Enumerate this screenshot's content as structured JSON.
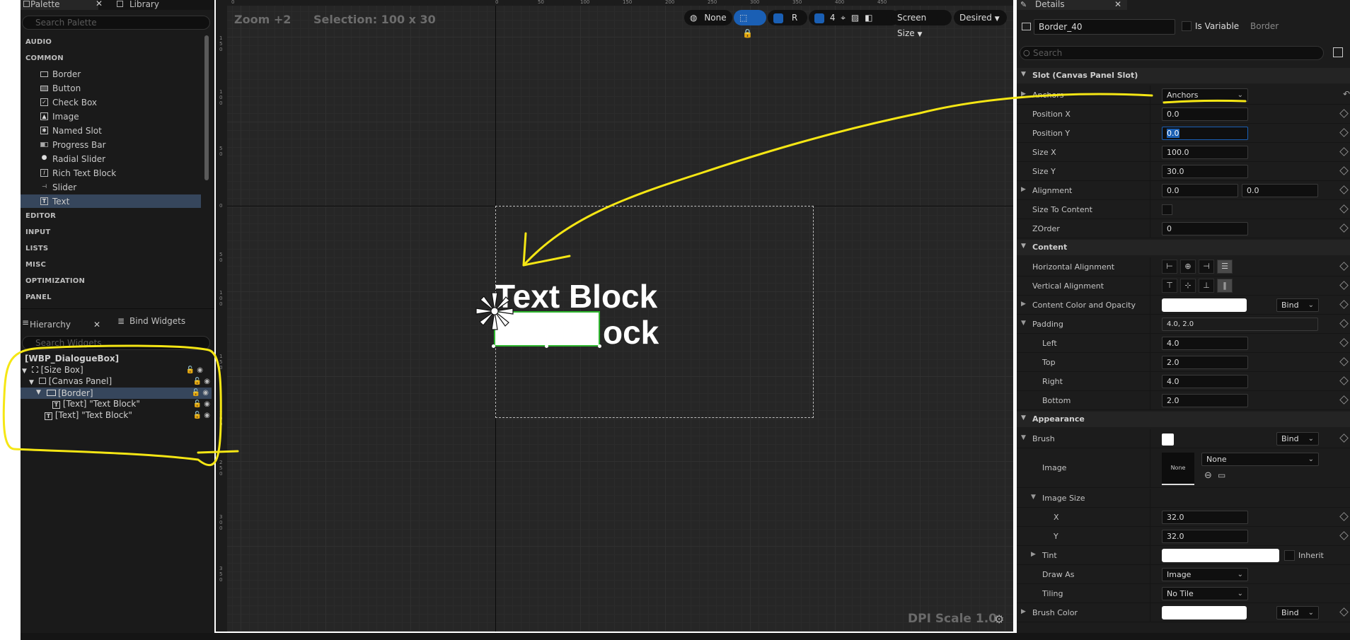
{
  "palette": {
    "tab_palette": "Palette",
    "tab_library": "Library",
    "search_placeholder": "Search Palette",
    "categories": [
      "AUDIO",
      "COMMON",
      "EDITOR",
      "INPUT",
      "LISTS",
      "MISC",
      "OPTIMIZATION",
      "PANEL"
    ],
    "common_items": [
      {
        "label": "Border",
        "icon": "border-icon"
      },
      {
        "label": "Button",
        "icon": "button-icon"
      },
      {
        "label": "Check Box",
        "icon": "checkbox-icon"
      },
      {
        "label": "Image",
        "icon": "image-icon"
      },
      {
        "label": "Named Slot",
        "icon": "named-slot-icon"
      },
      {
        "label": "Progress Bar",
        "icon": "progress-bar-icon"
      },
      {
        "label": "Radial Slider",
        "icon": "radial-slider-icon"
      },
      {
        "label": "Rich Text Block",
        "icon": "rich-text-icon"
      },
      {
        "label": "Slider",
        "icon": "slider-icon"
      },
      {
        "label": "Text",
        "icon": "text-icon"
      }
    ]
  },
  "hierarchy": {
    "tab_hierarchy": "Hierarchy",
    "tab_bind": "Bind Widgets",
    "search_placeholder": "Search Widgets",
    "root": "[WBP_DialogueBox]",
    "rows": [
      "[Size Box]",
      "[Canvas Panel]",
      "[Border]",
      "[Text] \"Text Block\"",
      "[Text] \"Text Block\""
    ]
  },
  "canvas": {
    "zoom": "Zoom +2",
    "selection": "Selection: 100 x 30",
    "toolbar": {
      "none_label": "None",
      "r_label": "R",
      "grid_value": "4",
      "screen_size": "Screen Size",
      "desired": "Desired"
    },
    "text_block_1": "Text Block",
    "text_block_2": "ock",
    "dpi_scale": "DPI Scale 1.0",
    "ruler_top": [
      "0",
      "50",
      "100",
      "150",
      "200",
      "250",
      "300",
      "350",
      "400",
      "450"
    ],
    "ruler_left": [
      "1\n5\n0",
      "1\n0\n0",
      "5\n0",
      "0",
      "5\n0",
      "1\n0\n0",
      "1\n5\n0",
      "2\n0\n0",
      "2\n5\n0",
      "3\n0\n0",
      "3\n5\n0"
    ]
  },
  "details": {
    "tab": "Details",
    "widget_name": "Border_40",
    "is_variable": "Is Variable",
    "type": "Border",
    "search_placeholder": "Search",
    "slot_section": "Slot (Canvas Panel Slot)",
    "anchors_label": "Anchors",
    "anchors_value": "Anchors",
    "position_x_label": "Position X",
    "position_x": "0.0",
    "position_y_label": "Position Y",
    "position_y": "0.0",
    "size_x_label": "Size X",
    "size_x": "100.0",
    "size_y_label": "Size Y",
    "size_y": "30.0",
    "alignment_label": "Alignment",
    "alignment_x": "0.0",
    "alignment_y": "0.0",
    "size_to_content_label": "Size To Content",
    "zorder_label": "ZOrder",
    "zorder": "0",
    "content_section": "Content",
    "h_align_label": "Horizontal Alignment",
    "v_align_label": "Vertical Alignment",
    "content_color_label": "Content Color and Opacity",
    "bind_label": "Bind",
    "padding_label": "Padding",
    "padding_value": "4.0, 2.0",
    "left_label": "Left",
    "left_value": "4.0",
    "top_label": "Top",
    "top_value": "2.0",
    "right_label": "Right",
    "right_value": "4.0",
    "bottom_label": "Bottom",
    "bottom_value": "2.0",
    "appearance_section": "Appearance",
    "brush_label": "Brush",
    "image_label": "Image",
    "image_thumb": "None",
    "image_value": "None",
    "image_size_label": "Image Size",
    "x_label": "X",
    "x_value": "32.0",
    "y_label": "Y",
    "y_value": "32.0",
    "tint_label": "Tint",
    "inherit_label": "Inherit",
    "draw_as_label": "Draw As",
    "draw_as_value": "Image",
    "tiling_label": "Tiling",
    "tiling_value": "No Tile",
    "brush_color_label": "Brush Color"
  },
  "colors": {
    "annotation": "#f5e614",
    "selection": "#36465c",
    "accent_blue": "#1a5fb4"
  }
}
